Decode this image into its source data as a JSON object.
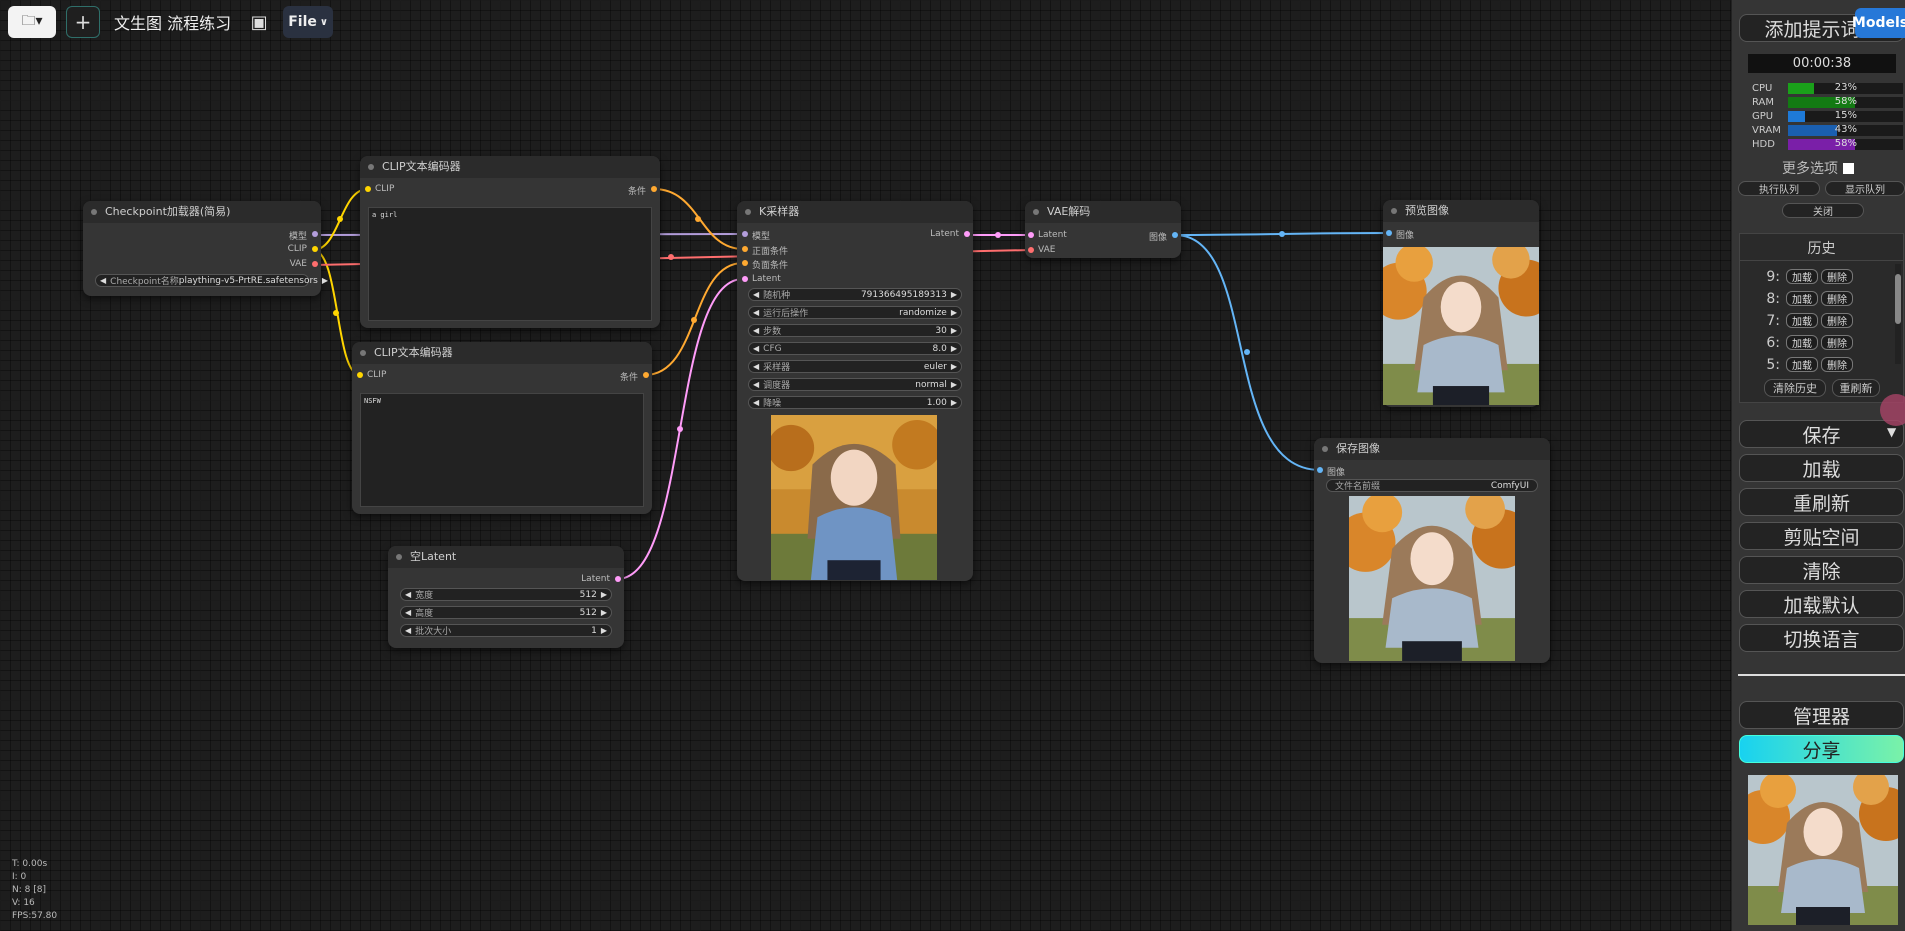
{
  "toolbar": {
    "folder_icon": "folder-icon",
    "title": "文生图 流程练习",
    "file_label": "File"
  },
  "nodes": {
    "checkpoint": {
      "title": "Checkpoint加载器(简易)",
      "out_model": "模型",
      "out_clip": "CLIP",
      "out_vae": "VAE",
      "widget_label": "Checkpoint名称",
      "widget_value": "plaything-v5-PrtRE.safetensors"
    },
    "clip_pos": {
      "title": "CLIP文本编码器",
      "in_clip": "CLIP",
      "out_cond": "条件",
      "text": "a girl"
    },
    "clip_neg": {
      "title": "CLIP文本编码器",
      "in_clip": "CLIP",
      "out_cond": "条件",
      "text": "NSFW"
    },
    "latent": {
      "title": "空Latent",
      "out_latent": "Latent",
      "widgets": [
        {
          "label": "宽度",
          "value": "512"
        },
        {
          "label": "高度",
          "value": "512"
        },
        {
          "label": "批次大小",
          "value": "1"
        }
      ]
    },
    "ksampler": {
      "title": "K采样器",
      "in_model": "模型",
      "in_pos": "正面条件",
      "in_neg": "负面条件",
      "in_latent": "Latent",
      "out_latent": "Latent",
      "widgets": [
        {
          "label": "随机种",
          "value": "791366495189313"
        },
        {
          "label": "运行后操作",
          "value": "randomize"
        },
        {
          "label": "步数",
          "value": "30"
        },
        {
          "label": "CFG",
          "value": "8.0"
        },
        {
          "label": "采样器",
          "value": "euler"
        },
        {
          "label": "调度器",
          "value": "normal"
        },
        {
          "label": "降噪",
          "value": "1.00"
        }
      ]
    },
    "vae_decode": {
      "title": "VAE解码",
      "in_latent": "Latent",
      "in_vae": "VAE",
      "out_image": "图像"
    },
    "preview": {
      "title": "预览图像",
      "in_image": "图像"
    },
    "save": {
      "title": "保存图像",
      "in_image": "图像",
      "widget_label": "文件名前缀",
      "widget_value": "ComfyUI"
    }
  },
  "sidebar": {
    "add_prompt": "添加提示词队",
    "timer": "00:00:38",
    "stats": [
      {
        "label": "CPU",
        "pct": "23%",
        "value": 0.23,
        "color": "#1aa01a"
      },
      {
        "label": "RAM",
        "pct": "58%",
        "value": 0.58,
        "color": "#137a13"
      },
      {
        "label": "GPU",
        "pct": "15%",
        "value": 0.15,
        "color": "#1e7ad8"
      },
      {
        "label": "VRAM",
        "pct": "43%",
        "value": 0.43,
        "color": "#1a5fb0"
      },
      {
        "label": "HDD",
        "pct": "58%",
        "value": 0.58,
        "color": "#7a1fa8"
      }
    ],
    "more_options": "更多选项",
    "queue_execute": "执行队列",
    "queue_show": "显示队列",
    "close": "关闭",
    "history_title": "历史",
    "history": [
      {
        "num": "9:",
        "load": "加载",
        "delete": "删除"
      },
      {
        "num": "8:",
        "load": "加载",
        "delete": "删除"
      },
      {
        "num": "7:",
        "load": "加载",
        "delete": "删除"
      },
      {
        "num": "6:",
        "load": "加载",
        "delete": "删除"
      },
      {
        "num": "5:",
        "load": "加载",
        "delete": "删除"
      }
    ],
    "clear_history": "清除历史",
    "refresh": "重刷新",
    "buttons": [
      "保存",
      "加载",
      "重刷新",
      "剪贴空间",
      "清除",
      "加载默认",
      "切换语言"
    ],
    "manager": "管理器",
    "share": "分享",
    "models": "Models"
  },
  "overlay": {
    "t": "T: 0.00s",
    "i": "I: 0",
    "n": "N: 8 [8]",
    "v": "V: 16",
    "fps": "FPS:57.80"
  }
}
